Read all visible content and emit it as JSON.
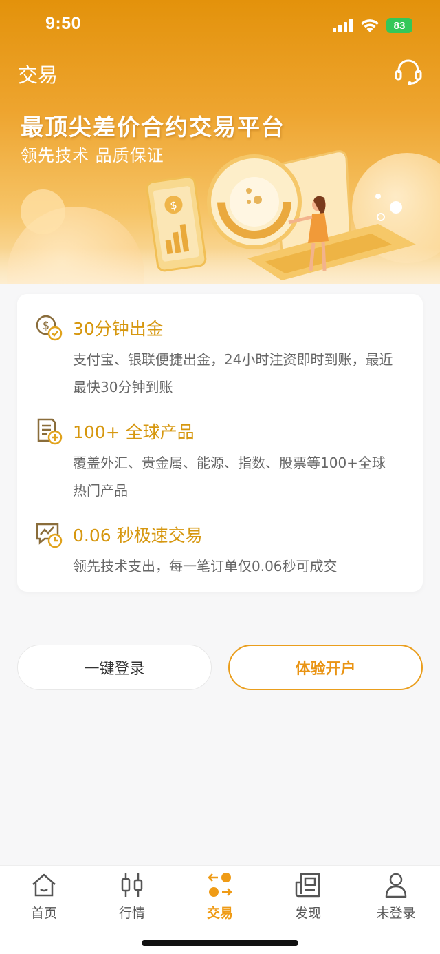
{
  "status_bar": {
    "time": "9:50",
    "battery": "83"
  },
  "header": {
    "title": "交易",
    "support_icon": "headset-icon"
  },
  "hero": {
    "title": "最顶尖差价合约交易平台",
    "subtitle": "领先技术 品质保证"
  },
  "features": [
    {
      "icon": "dollar-check-icon",
      "title": "30分钟出金",
      "desc": "支付宝、银联便捷出金，24小时注资即时到账，最近最快30分钟到账"
    },
    {
      "icon": "document-plus-icon",
      "title": "100+ 全球产品",
      "desc": "覆盖外汇、贵金属、能源、指数、股票等100+全球热门产品"
    },
    {
      "icon": "chart-clock-icon",
      "title": "0.06 秒极速交易",
      "desc": "领先技术支出，每一笔订单仅0.06秒可成交"
    }
  ],
  "actions": {
    "login": "一键登录",
    "open_account": "体验开户"
  },
  "tabbar": {
    "items": [
      {
        "label": "首页",
        "icon": "home-icon"
      },
      {
        "label": "行情",
        "icon": "candlestick-icon"
      },
      {
        "label": "交易",
        "icon": "trade-exchange-icon",
        "active": true
      },
      {
        "label": "发现",
        "icon": "newspaper-icon"
      },
      {
        "label": "未登录",
        "icon": "user-icon"
      }
    ]
  },
  "colors": {
    "accent": "#ef9b16",
    "feature_title": "#d6970f",
    "hero_top": "#e3920b"
  }
}
